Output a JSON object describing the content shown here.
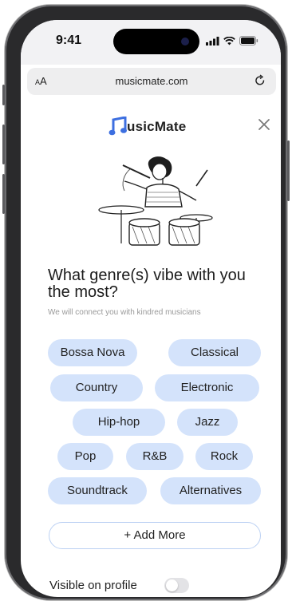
{
  "status_bar": {
    "time": "9:41",
    "signal_icon": "cellular-signal-icon",
    "wifi_icon": "wifi-icon",
    "battery_icon": "battery-icon"
  },
  "browser": {
    "text_size_label_small": "A",
    "text_size_label_large": "A",
    "url": "musicmate.com",
    "reload_icon": "reload-icon"
  },
  "brand": {
    "logo_icon": "music-note-icon",
    "name": "usicMate",
    "accent_color": "#3d6fe0"
  },
  "close_icon": "close-icon",
  "hero": {
    "illustration": "drummer-illustration"
  },
  "question": {
    "title": "What genre(s) vibe with you the most?",
    "subtitle": "We will connect you with kindred musicians"
  },
  "genres": [
    "Bossa Nova",
    "Classical",
    "Country",
    "Electronic",
    "Hip-hop",
    "Jazz",
    "Pop",
    "R&B",
    "Rock",
    "Soundtrack",
    "Alternatives"
  ],
  "chip_color": "#d4e3fb",
  "add_more_label": "+ Add More",
  "visibility": {
    "label": "Visible on profile",
    "enabled": false
  }
}
